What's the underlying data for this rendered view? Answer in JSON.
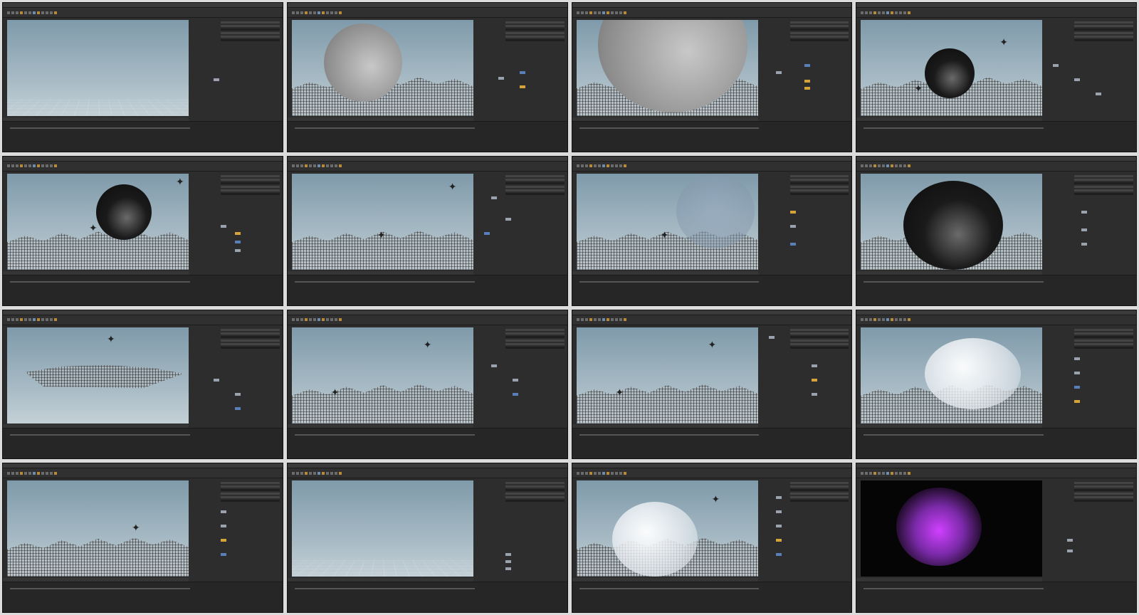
{
  "tiles": [
    {
      "scene": "empty"
    },
    {
      "scene": "grey-sphere-terrain"
    },
    {
      "scene": "grey-sphere-close"
    },
    {
      "scene": "black-sphere-figures"
    },
    {
      "scene": "black-sphere-terrain"
    },
    {
      "scene": "terrain-figures"
    },
    {
      "scene": "cloud-sphere"
    },
    {
      "scene": "big-black-sphere"
    },
    {
      "scene": "tilted-terrain"
    },
    {
      "scene": "terrain-figures-2"
    },
    {
      "scene": "terrain-figures-3"
    },
    {
      "scene": "foam-sphere"
    },
    {
      "scene": "terrain-single-figure"
    },
    {
      "scene": "empty"
    },
    {
      "scene": "foam-sphere-figure"
    },
    {
      "scene": "purple-burst-dark"
    }
  ]
}
